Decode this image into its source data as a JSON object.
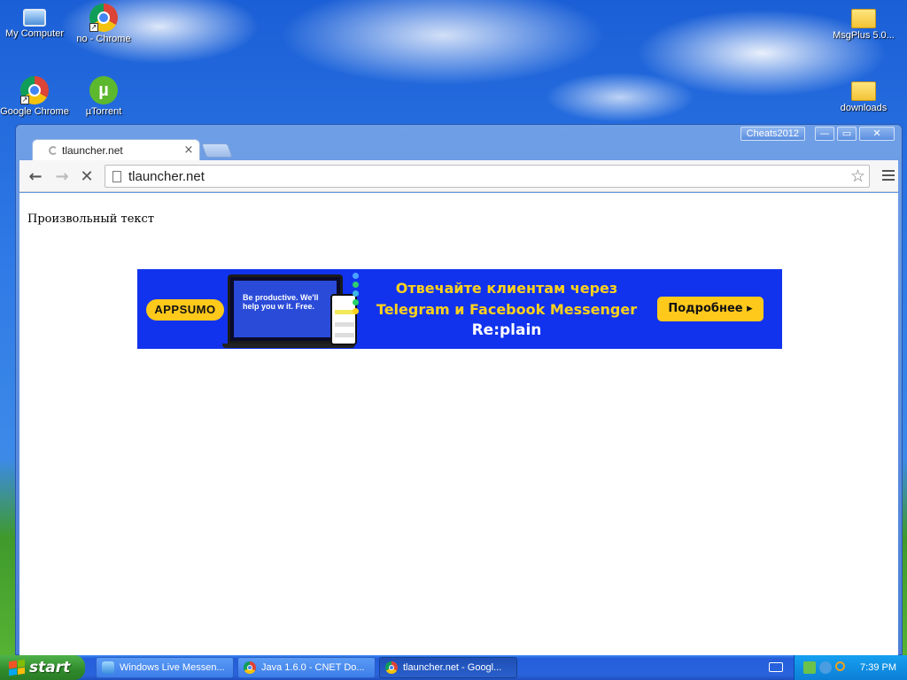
{
  "desktop": {
    "icons": [
      {
        "label": "My Computer",
        "icon": "computer-icon"
      },
      {
        "label": "no - Chrome",
        "icon": "chrome-icon"
      },
      {
        "label": "Google Chrome",
        "icon": "chrome-icon"
      },
      {
        "label": "µTorrent",
        "icon": "utorrent-icon"
      },
      {
        "label": "MsgPlus 5.0...",
        "icon": "folder-icon"
      },
      {
        "label": "downloads",
        "icon": "folder-icon"
      }
    ],
    "utorrent_glyph": "µ",
    "shortcut_glyph": "↗"
  },
  "browser": {
    "profile_name": "Cheats2012",
    "caption": {
      "minimize": "—",
      "maximize": "▭",
      "close": "✕"
    },
    "tab": {
      "title": "tlauncher.net",
      "close": "×"
    },
    "toolbar": {
      "back": "←",
      "forward": "→",
      "stop": "✕",
      "star": "☆"
    },
    "omnibox": {
      "value": "tlauncher.net"
    },
    "page": {
      "text": "Произвольный текст",
      "ad": {
        "appsumo": "APPSUMO",
        "device_text": "Be productive. We'll help you w it. Free.",
        "line1": "Отвечайте клиентам через",
        "line2": "Telegram и Facebook Messenger",
        "brand": "Re:plain",
        "cta": "Подробнее ▸"
      }
    }
  },
  "taskbar": {
    "start_label": "start",
    "tasks": [
      {
        "label": "Windows Live Messen...",
        "icon": "msn-icon",
        "active": false
      },
      {
        "label": "Java 1.6.0 - CNET Do...",
        "icon": "chrome-icon",
        "active": false
      },
      {
        "label": "tlauncher.net - Googl...",
        "icon": "chrome-icon",
        "active": true
      }
    ],
    "clock": "7:39 PM"
  },
  "colors": {
    "taskbar_blue": "#245edb",
    "start_green": "#3a9a35",
    "ad_blue": "#1133ee",
    "ad_yellow": "#ffc91c"
  }
}
